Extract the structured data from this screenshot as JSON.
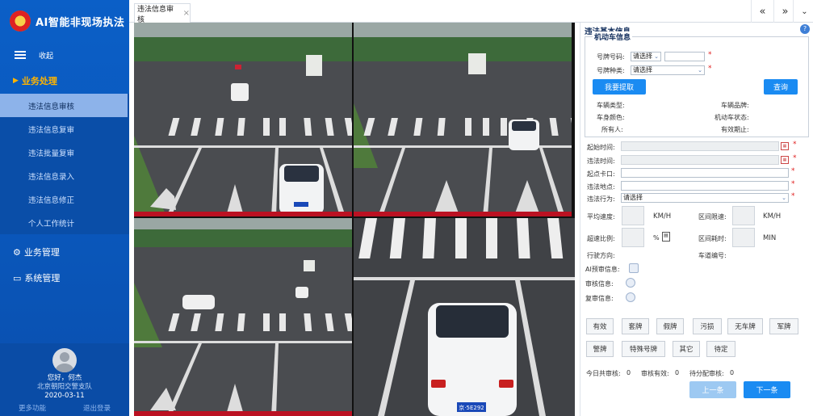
{
  "app": {
    "title": "AI智能非现场执法"
  },
  "sidebar": {
    "collapse_label": "收起",
    "groups": [
      {
        "label": "业务处理",
        "icon": "briefcase-icon"
      },
      {
        "label": "业务管理",
        "icon": "gear-icon"
      },
      {
        "label": "系统管理",
        "icon": "monitor-icon"
      }
    ],
    "items": [
      {
        "label": "违法信息审核"
      },
      {
        "label": "违法信息复审"
      },
      {
        "label": "违法批量复审"
      },
      {
        "label": "违法信息录入"
      },
      {
        "label": "违法信息修正"
      },
      {
        "label": "个人工作统计"
      }
    ]
  },
  "user": {
    "greeting": "您好，何杰",
    "org": "北京朝阳交警支队",
    "date": "2020-03-11",
    "more": "更多功能",
    "logout": "退出登录"
  },
  "tabs": [
    {
      "label": "违法信息审核"
    }
  ],
  "panel": {
    "title": "违法基本信息",
    "vehicle_legend": "机动车信息",
    "plate_no_label": "号牌号码:",
    "plate_no_select": "请选择",
    "plate_type_label": "号牌种类:",
    "plate_type_select": "请选择",
    "extract_btn": "我要提取",
    "query_btn": "查询",
    "vehicle_type": "车辆类型:",
    "vehicle_brand": "车辆品牌:",
    "body_color": "车身颜色:",
    "vehicle_status": "机动车状态:",
    "owner": "所有人:",
    "valid_until": "有效期止:",
    "start_time": "起始时间:",
    "violation_time": "违法时间:",
    "checkpoint": "起点卡口:",
    "location": "违法地点:",
    "behavior": "违法行为:",
    "behavior_select": "请选择",
    "avg_speed": "平均速度:",
    "unit_kmh": "KM/H",
    "zone_limit": "区间限速:",
    "unit_kmh2": "KM/H",
    "overspeed_ratio": "超速比例:",
    "unit_pct": "%",
    "zone_time": "区间耗时:",
    "unit_min": "MIN",
    "direction": "行驶方向:",
    "lane_no": "车道编号:",
    "ai_review": "AI预审信息:",
    "audit_info": "审核信息:",
    "recheck_info": "复审信息:",
    "actions_row1": [
      "有效",
      "套牌",
      "假牌",
      "污损",
      "无车牌",
      "军牌"
    ],
    "actions_row2": [
      "警牌",
      "特殊号牌",
      "其它",
      "待定"
    ],
    "stats": [
      {
        "label": "今日共审核:",
        "value": "0"
      },
      {
        "label": "审核有效:",
        "value": "0"
      },
      {
        "label": "待分配审核:",
        "value": "0"
      }
    ],
    "prev_btn": "上一条",
    "next_btn": "下一条"
  },
  "camera": {
    "plate_text": "京·5E292"
  },
  "colors": {
    "sidebar": "#0b5fc7",
    "accent": "#1a8bf2",
    "active_group": "#ffb400"
  }
}
